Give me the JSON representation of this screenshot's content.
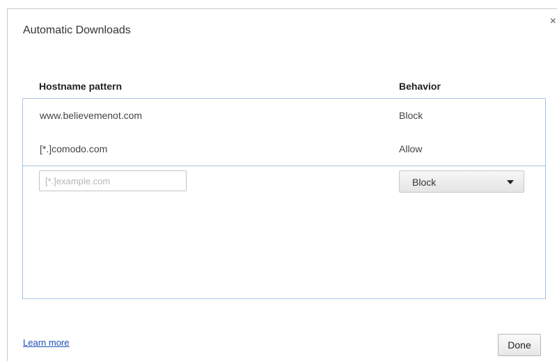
{
  "dialog": {
    "title": "Automatic Downloads",
    "close_icon": "×"
  },
  "columns": {
    "hostname": "Hostname pattern",
    "behavior": "Behavior"
  },
  "exceptions": [
    {
      "host": "www.believemenot.com",
      "behavior": "Block"
    },
    {
      "host": "[*.]comodo.com",
      "behavior": "Allow"
    }
  ],
  "new_entry": {
    "placeholder": "[*.]example.com",
    "value": "",
    "behavior_selected": "Block"
  },
  "footer": {
    "learn_more": "Learn more",
    "done": "Done"
  },
  "colors": {
    "accent_border": "#a7c3e3",
    "link": "#1a4fb5"
  }
}
